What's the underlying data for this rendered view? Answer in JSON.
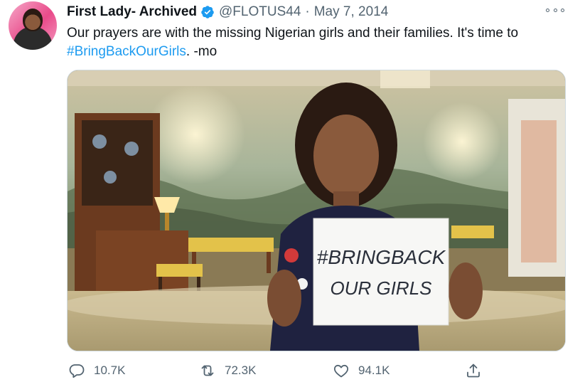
{
  "tweet": {
    "author_name": "First Lady- Archived",
    "handle": "@FLOTUS44",
    "separator": "·",
    "date": "May 7, 2014",
    "text_part1": "Our prayers are with the missing Nigerian girls and their families. It's time to",
    "hashtag": "#BringBackOurGirls",
    "text_part2": ". -mo",
    "photo_sign_line1": "#BRINGBACK",
    "photo_sign_line2": "OUR GIRLS"
  },
  "actions": {
    "reply_count": "10.7K",
    "retweet_count": "72.3K",
    "like_count": "94.1K"
  },
  "icons": {
    "verified": "verified-badge-icon",
    "more": "more-icon",
    "reply": "reply-icon",
    "retweet": "retweet-icon",
    "like": "like-icon",
    "share": "share-icon"
  },
  "colors": {
    "link": "#1d9bf0",
    "muted": "#536471",
    "text": "#0f1419"
  }
}
